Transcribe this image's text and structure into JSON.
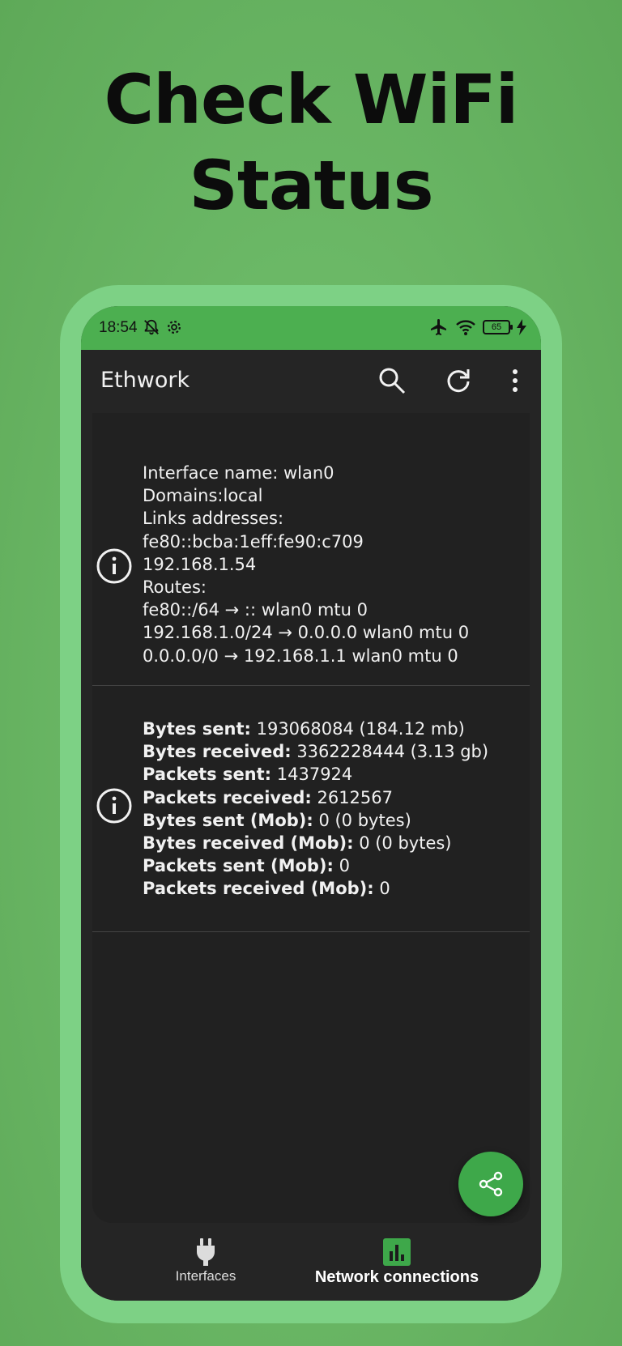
{
  "headline": {
    "line1": "Check WiFi",
    "line2": "Status"
  },
  "colors": {
    "background": "#6bb866",
    "statusbar": "#4caf50",
    "fab": "#3ea84a",
    "screen": "#252525",
    "text": "#f1f1f1"
  },
  "statusbar": {
    "time": "18:54",
    "battery": "65",
    "icons": [
      "bell-off-icon",
      "settings-icon",
      "airplane-icon",
      "wifi-icon",
      "battery-icon",
      "charging-icon"
    ]
  },
  "appbar": {
    "title": "Ethwork",
    "actions": [
      "search-icon",
      "refresh-icon",
      "more-vert-icon"
    ]
  },
  "interface_card": {
    "lines": [
      "Interface name: wlan0",
      "Domains:local",
      "Links addresses:",
      "fe80::bcba:1eff:fe90:c709",
      "192.168.1.54",
      "Routes:",
      "fe80::/64 → :: wlan0 mtu 0",
      "192.168.1.0/24 → 0.0.0.0 wlan0 mtu 0",
      "0.0.0.0/0 → 192.168.1.1 wlan0 mtu 0"
    ]
  },
  "stats_card": {
    "rows": [
      {
        "label": "Bytes sent:",
        "value": " 193068084 (184.12 mb)"
      },
      {
        "label": "Bytes received:",
        "value": " 3362228444 (3.13 gb)"
      },
      {
        "label": "Packets sent:",
        "value": " 1437924"
      },
      {
        "label": "Packets received:",
        "value": " 2612567"
      },
      {
        "label": "Bytes sent (Mob):",
        "value": " 0 (0 bytes)"
      },
      {
        "label": "Bytes received (Mob):",
        "value": " 0 (0 bytes)"
      },
      {
        "label": "Packets sent (Mob):",
        "value": " 0"
      },
      {
        "label": "Packets received (Mob):",
        "value": " 0"
      }
    ]
  },
  "fab": {
    "icon": "share-icon"
  },
  "bottom_nav": {
    "items": [
      {
        "label": "Interfaces",
        "icon": "plug-icon",
        "selected": false
      },
      {
        "label": "Network connections",
        "icon": "bar-chart-icon",
        "selected": true
      }
    ]
  }
}
